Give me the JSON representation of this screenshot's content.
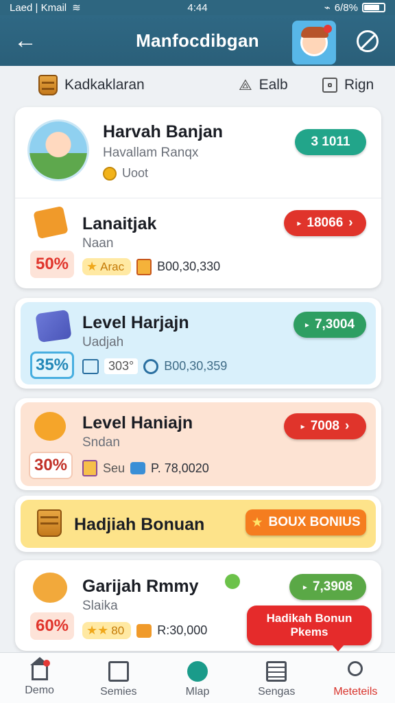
{
  "status_bar": {
    "carrier": "Laed | Kmail",
    "time": "4:44",
    "battery": "6/8%"
  },
  "header": {
    "back_icon": "arrow-left-icon",
    "title": "Manfocdibgan",
    "avatar_icon": "avatar-icon",
    "block_icon": "block-icon"
  },
  "sub_bar": {
    "left_label": "Kadkaklaran",
    "middle_label": "Ealb",
    "right_label": "Rign"
  },
  "profile": {
    "name": "Harvah Banjan",
    "subtitle": "Havallam Ranqx",
    "coin_label": "Uoot",
    "badge": "3 1011"
  },
  "cards": [
    {
      "title": "Lanaitjak",
      "subtitle": "Naan",
      "percent": "50%",
      "chip_label": "Arac",
      "amount": "B00,30,330",
      "button": "18066",
      "button_color": "#e0342b"
    },
    {
      "title": "Level Harjajn",
      "subtitle": "Uadjah",
      "percent": "35%",
      "chip_label": "303°",
      "amount": "B00,30,359",
      "button": "7,3004",
      "button_color": "#2e9e62"
    },
    {
      "title": "Level Haniajn",
      "subtitle": "Sndan",
      "percent": "30%",
      "chip_label": "Seu",
      "amount": "P. 78,0020",
      "button": "7008",
      "button_color": "#e0342b"
    },
    {
      "title": "Hadjiah Bonuan",
      "button": "BOUX BONIUS",
      "button_color": "#f57d1f"
    },
    {
      "title": "Garijah Rmmy",
      "subtitle": "Slaika",
      "percent": "60%",
      "chip_label": "80",
      "amount": "R:30,000",
      "button": "7,3908",
      "button_color": "#5aa846"
    }
  ],
  "tooltip": {
    "line1": "Hadikah Bonun",
    "line2": "Pkems"
  },
  "nav": [
    {
      "label": "Demo",
      "icon": "home-icon"
    },
    {
      "label": "Semies",
      "icon": "grid-icon"
    },
    {
      "label": "Mlap",
      "icon": "map-icon"
    },
    {
      "label": "Sengas",
      "icon": "list-icon"
    },
    {
      "label": "Meteteils",
      "icon": "user-icon"
    }
  ]
}
